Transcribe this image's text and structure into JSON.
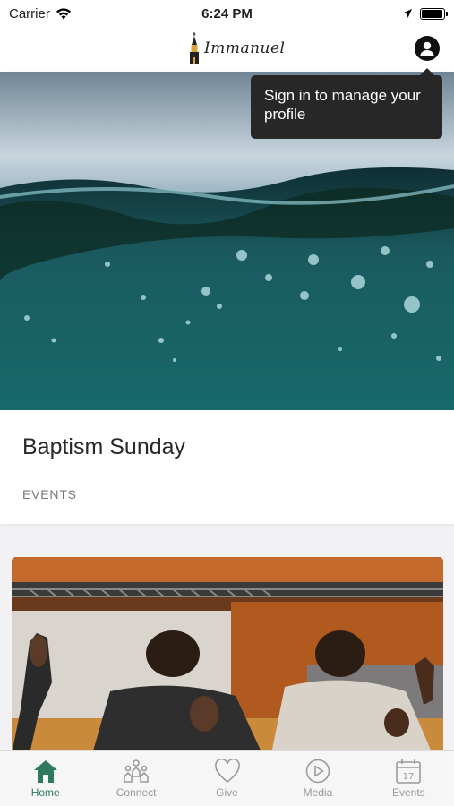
{
  "status_bar": {
    "carrier": "Carrier",
    "time": "6:24 PM",
    "battery_level": 0.9
  },
  "header": {
    "app_name": "Immanuel",
    "profile_icon": "person-circle-icon"
  },
  "tooltip": {
    "text": "Sign in to manage your profile"
  },
  "feed": {
    "cards": [
      {
        "title": "Baptism Sunday",
        "category": "EVENTS"
      }
    ]
  },
  "tab_bar": {
    "items": [
      {
        "label": "Home",
        "icon": "home-icon",
        "active": true
      },
      {
        "label": "Connect",
        "icon": "people-icon",
        "active": false
      },
      {
        "label": "Give",
        "icon": "heart-icon",
        "active": false
      },
      {
        "label": "Media",
        "icon": "play-icon",
        "active": false
      },
      {
        "label": "Events",
        "icon": "calendar-icon",
        "active": false
      }
    ]
  },
  "colors": {
    "accent": "#2f7a5d",
    "tooltip_bg": "#272727",
    "inactive": "#9a9a9a"
  }
}
